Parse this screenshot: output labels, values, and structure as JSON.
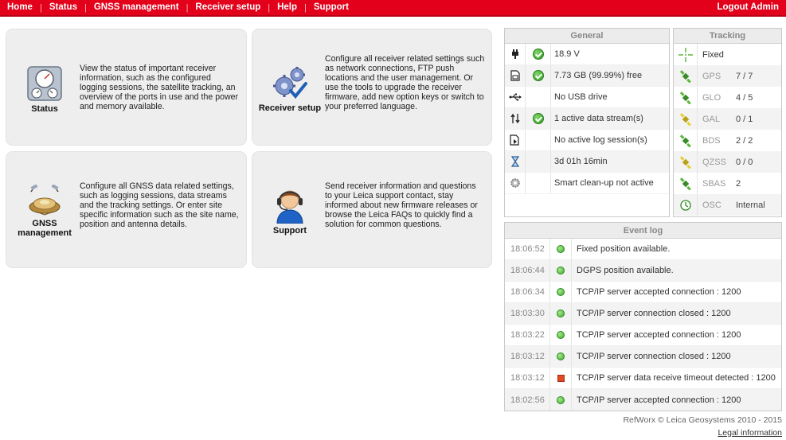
{
  "nav": {
    "items": [
      "Home",
      "Status",
      "GNSS management",
      "Receiver setup",
      "Help",
      "Support"
    ],
    "logout": "Logout Admin"
  },
  "tiles": {
    "status": {
      "label": "Status",
      "desc": "View the status of important receiver information, such as the configured logging sessions, the satellite tracking, an overview of the ports in use and the power and memory available."
    },
    "receiver_setup": {
      "label": "Receiver setup",
      "desc": "Configure all receiver related settings such as network connections, FTP push locations and the user management. Or use the tools to upgrade the receiver firmware, add new option keys or switch to your preferred language."
    },
    "gnss": {
      "label_line1": "GNSS",
      "label_line2": "management",
      "desc": "Configure all GNSS data related settings, such as logging sessions, data streams and the tracking settings. Or enter site specific information such as the site name, position and antenna details."
    },
    "support": {
      "label": "Support",
      "desc": "Send receiver information and questions to your Leica support contact, stay informed about new firmware releases or browse the Leica FAQs to quickly find a solution for common questions."
    }
  },
  "general": {
    "title": "General",
    "rows": [
      {
        "icon": "power-plug-icon",
        "ok": true,
        "text": "18.9 V"
      },
      {
        "icon": "memory-card-icon",
        "ok": true,
        "text": "7.73 GB (99.99%) free"
      },
      {
        "icon": "usb-icon",
        "ok": false,
        "text": "No USB drive"
      },
      {
        "icon": "data-stream-icon",
        "ok": true,
        "text": "1 active data stream(s)"
      },
      {
        "icon": "log-session-icon",
        "ok": false,
        "text": "No active log session(s)"
      },
      {
        "icon": "hourglass-icon",
        "ok": false,
        "text": "3d 01h 16min"
      },
      {
        "icon": "cleanup-gear-icon",
        "ok": false,
        "text": "Smart clean-up not active"
      }
    ]
  },
  "tracking": {
    "title": "Tracking",
    "fixed_label": "Fixed",
    "rows": [
      {
        "icon": "satellite-green-icon",
        "system": "GPS",
        "value": "7 / 7"
      },
      {
        "icon": "satellite-green-icon",
        "system": "GLO",
        "value": "4 / 5"
      },
      {
        "icon": "satellite-yellow-icon",
        "system": "GAL",
        "value": "0 / 1"
      },
      {
        "icon": "satellite-green-icon",
        "system": "BDS",
        "value": "2 / 2"
      },
      {
        "icon": "satellite-yellow-icon",
        "system": "QZSS",
        "value": "0 / 0"
      },
      {
        "icon": "satellite-green-icon",
        "system": "SBAS",
        "value": "2"
      },
      {
        "icon": "clock-icon",
        "system": "OSC",
        "value": "Internal"
      }
    ]
  },
  "eventlog": {
    "title": "Event log",
    "rows": [
      {
        "time": "18:06:52",
        "status": "ok",
        "text": "Fixed position available."
      },
      {
        "time": "18:06:44",
        "status": "ok",
        "text": "DGPS position available."
      },
      {
        "time": "18:06:34",
        "status": "ok",
        "text": "TCP/IP server accepted connection : 1200"
      },
      {
        "time": "18:03:30",
        "status": "ok",
        "text": "TCP/IP server connection closed : 1200"
      },
      {
        "time": "18:03:22",
        "status": "ok",
        "text": "TCP/IP server accepted connection : 1200"
      },
      {
        "time": "18:03:12",
        "status": "ok",
        "text": "TCP/IP server connection closed : 1200"
      },
      {
        "time": "18:03:12",
        "status": "error",
        "text": "TCP/IP server data receive timeout detected : 1200"
      },
      {
        "time": "18:02:56",
        "status": "ok",
        "text": "TCP/IP server accepted connection : 1200"
      }
    ]
  },
  "footer": {
    "copyright": "RefWorx © Leica Geosystems 2010 - 2015",
    "legal": "Legal information"
  },
  "colors": {
    "brand_red": "#e2001a",
    "ok_green": "#3ea92b",
    "error_red": "#e04a25"
  }
}
